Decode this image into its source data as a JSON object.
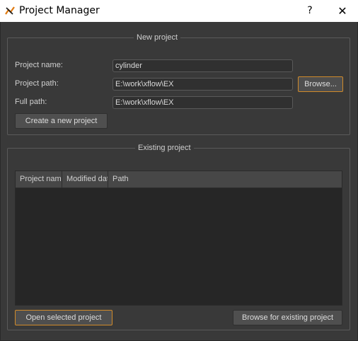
{
  "window": {
    "title": "Project Manager",
    "help_glyph": "?",
    "close_glyph": "✕",
    "icon": "xflow-app-icon"
  },
  "new_project": {
    "group_title": "New project",
    "name_label": "Project name:",
    "name_value": "cylinder",
    "path_label": "Project path:",
    "path_value": "E:\\work\\xflow\\EX",
    "browse_label": "Browse...",
    "full_path_label": "Full path:",
    "full_path_value": "E:\\work\\xflow\\EX",
    "create_label": "Create a new project"
  },
  "existing_project": {
    "group_title": "Existing project",
    "columns": [
      "Project name",
      "Modified date",
      "Path"
    ],
    "rows": [],
    "open_label": "Open selected project",
    "browse_existing_label": "Browse for existing project"
  },
  "colors": {
    "background": "#393939",
    "accent_highlight": "#d08a2a",
    "table_bg": "#262626"
  }
}
